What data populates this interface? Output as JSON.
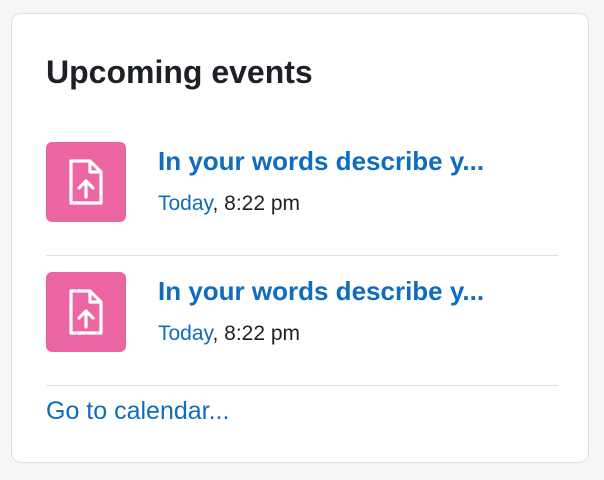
{
  "block": {
    "title": "Upcoming events"
  },
  "events": [
    {
      "title": "In your words describe y...",
      "date_link": "Today",
      "time_suffix": ", 8:22 pm",
      "icon": "assignment-upload-icon",
      "icon_color": "#eb66a2"
    },
    {
      "title": "In your words describe y...",
      "date_link": "Today",
      "time_suffix": ", 8:22 pm",
      "icon": "assignment-upload-icon",
      "icon_color": "#eb66a2"
    }
  ],
  "footer": {
    "calendar_link": "Go to calendar..."
  },
  "colors": {
    "link": "#0f6cbf",
    "text": "#1d2125",
    "icon_bg": "#eb66a2"
  }
}
